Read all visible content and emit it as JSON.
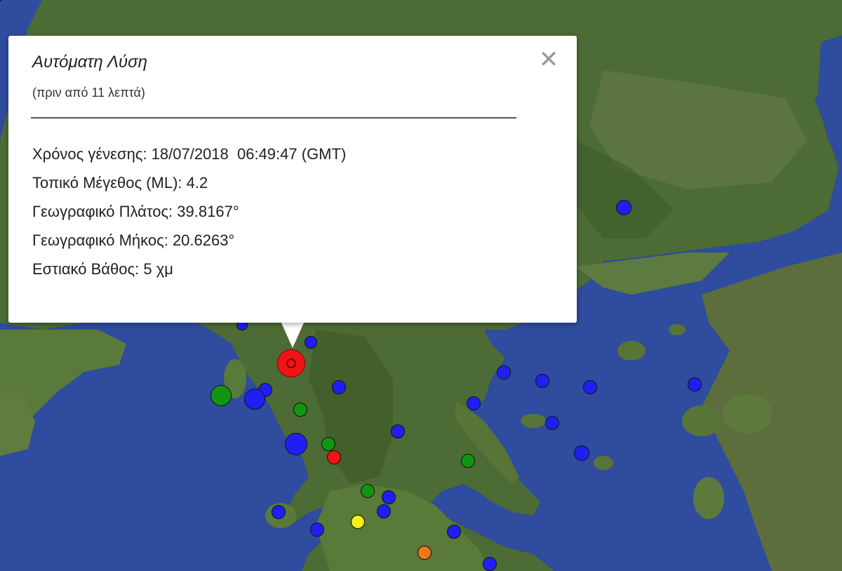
{
  "popup": {
    "title": "Αυτόματη Λύση",
    "subtitle": "(πριν από 11 λεπτά)",
    "close_symbol": "✕",
    "fields": [
      {
        "label": "Χρόνος γένεσης:",
        "value": "18/07/2018  06:49:47 (GMT)"
      },
      {
        "label": "Τοπικό Μέγεθος (ML):",
        "value": "4.2"
      },
      {
        "label": "Γεωγραφικό Πλάτος:",
        "value": "39.8167°"
      },
      {
        "label": "Γεωγραφικό Μήκος:",
        "value": "20.6263°"
      },
      {
        "label": "Εστιακό Βάθος:",
        "value": "5 χμ"
      }
    ]
  },
  "close_icon": "close-icon",
  "colors": {
    "red": "#f21414",
    "blue": "#1f1ff5",
    "green": "#119611",
    "yellow": "#f2f21a",
    "orange": "#f0771e",
    "sea": "#2e4a9c",
    "land": "#4d6b34"
  },
  "earthquake_markers": [
    {
      "color": "red",
      "selected": true
    },
    {
      "color": "blue"
    },
    {
      "color": "blue"
    },
    {
      "color": "blue"
    },
    {
      "color": "blue"
    },
    {
      "color": "blue"
    },
    {
      "color": "green"
    },
    {
      "color": "blue"
    },
    {
      "color": "blue"
    },
    {
      "color": "green"
    },
    {
      "color": "blue"
    },
    {
      "color": "blue"
    },
    {
      "color": "green"
    },
    {
      "color": "red"
    },
    {
      "color": "green"
    },
    {
      "color": "green"
    },
    {
      "color": "blue"
    },
    {
      "color": "blue"
    },
    {
      "color": "blue"
    },
    {
      "color": "yellow"
    },
    {
      "color": "blue"
    },
    {
      "color": "blue"
    },
    {
      "color": "orange"
    },
    {
      "color": "blue"
    },
    {
      "color": "blue"
    },
    {
      "color": "blue"
    },
    {
      "color": "blue"
    },
    {
      "color": "blue"
    },
    {
      "color": "blue"
    },
    {
      "color": "blue"
    },
    {
      "color": "blue"
    }
  ]
}
